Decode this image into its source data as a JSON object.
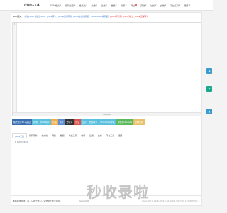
{
  "nav": {
    "logo": "在线加入工具",
    "items": [
      {
        "label": "JSON相关",
        "dropdown": true
      },
      {
        "label": "编码加密",
        "dropdown": true
      },
      {
        "label": "格式化",
        "dropdown": true
      },
      {
        "label": "前端",
        "dropdown": true
      },
      {
        "label": "后端",
        "dropdown": true
      },
      {
        "label": "数据",
        "dropdown": true
      },
      {
        "label": "资源",
        "dropdown": true
      },
      {
        "label": "网站",
        "dropdown": false,
        "hot": true
      },
      {
        "label": "其他",
        "dropdown": true
      },
      {
        "label": "站长",
        "dropdown": true
      },
      {
        "label": "文档",
        "dropdown": true
      },
      {
        "label": "平台工具",
        "dropdown": true
      },
      {
        "label": "更多",
        "dropdown": true
      }
    ]
  },
  "links": {
    "lead": "json相关：",
    "items": [
      {
        "label": "校验JSON",
        "red": false
      },
      {
        "label": "格式JSON",
        "red": false
      },
      {
        "label": "JSON转义",
        "red": false
      },
      {
        "label": "JSON在线转换",
        "red": false
      },
      {
        "label": "JSON在线编辑器",
        "red": false
      },
      {
        "label": "Markdown编辑器",
        "red": false
      },
      {
        "label": "JSON转代码",
        "red": true
      },
      {
        "label": "JSON对比",
        "red": true
      },
      {
        "label": "JSON压缩转义",
        "red": true
      }
    ]
  },
  "editor": {
    "line_number": "1"
  },
  "buttons": [
    {
      "label": "格式化(Ctrl+适应)",
      "color": "#3a6fb0"
    },
    {
      "label": "校验",
      "color": "#5bc0de"
    },
    {
      "label": "JSON转义",
      "color": "#5bc0de"
    },
    {
      "label": "压缩",
      "color": "#f0ad4e"
    },
    {
      "label": "转义",
      "color": "#5b8fd1"
    },
    {
      "label": "去转义",
      "color": "#333333"
    },
    {
      "label": "清空",
      "color": "#d9534f"
    },
    {
      "label": "显示",
      "color": "#5bc0de"
    },
    {
      "label": "去除转义",
      "color": "#5bc0de"
    },
    {
      "label": "Unicode转中文",
      "color": "#5bc0de"
    },
    {
      "label": "中文转Unicode",
      "color": "#5cb85c"
    },
    {
      "label": "复制代码",
      "color": "#e8c06a"
    }
  ],
  "tabs": [
    {
      "label": "JSON工具",
      "active": true
    },
    {
      "label": "编码转换",
      "active": false
    },
    {
      "label": "格式化",
      "active": false
    },
    {
      "label": "网络",
      "active": false
    },
    {
      "label": "数据",
      "active": false
    },
    {
      "label": "站长工具",
      "active": false
    },
    {
      "label": "前端",
      "active": false
    },
    {
      "label": "后端",
      "active": false
    },
    {
      "label": "文档",
      "active": false
    },
    {
      "label": "平台工具",
      "active": false
    },
    {
      "label": "更多",
      "active": false
    }
  ],
  "output": {
    "toggle_label": "{}",
    "tree_text": "解析结果",
    "count": "0"
  },
  "footer": {
    "note": "本站提供在线工具，只用于学习，请勿用于非法用途。",
    "copyright": "Copyright",
    "icp": "Copyright © 2016-2023 In All Rights 备案号ICP 123456789号-1"
  },
  "watermark": "秒收录啦",
  "floats": [
    {
      "icon": "chat-icon",
      "color": "#3d9ad1"
    },
    {
      "icon": "share-icon",
      "color": "#1aa88c"
    },
    {
      "icon": "top-icon",
      "color": "#3d9ad1"
    }
  ]
}
